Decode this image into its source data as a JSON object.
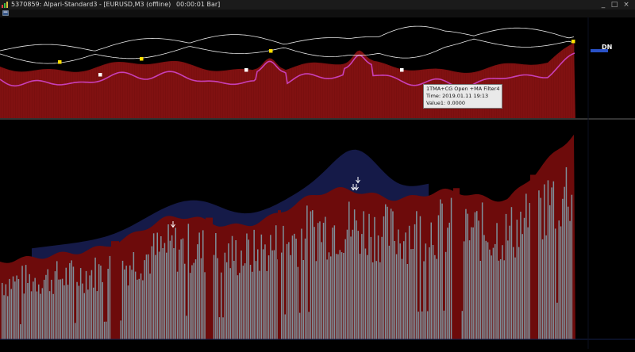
{
  "window": {
    "title": "5370859: Alpari-Standard3 - [EURUSD,M3 (offline)",
    "status": "00:00:01 Bar]",
    "buttons": {
      "minimize": "_",
      "maximize": "□",
      "close": "×"
    }
  },
  "panes": {
    "top": {
      "signal_label": "DN"
    },
    "tooltip": {
      "line1": "1TMA+CG Open +MA Filter4",
      "line2": "Time: 2019.01.11 19:13",
      "line3": "Value1: 0.0000"
    }
  },
  "icons": [
    "app-icon",
    "submenu-icon",
    "minimize-icon",
    "maximize-icon",
    "close-icon",
    "arrow-down-icon"
  ],
  "colors": {
    "background": "#000000",
    "dark_red_fill": "#7a0f0f",
    "bars": "#7e909a",
    "blue_band": "#151a48",
    "magenta_line": "#c83fb8",
    "white_band": "#e8e8e8",
    "signal_yellow": "#ffe000"
  }
}
